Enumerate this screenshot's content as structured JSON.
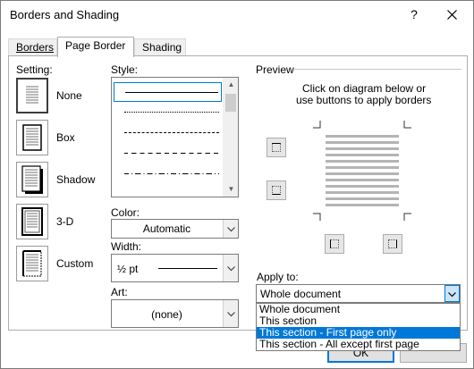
{
  "window": {
    "title": "Borders and Shading",
    "help_glyph": "?",
    "close_icon": "close-icon"
  },
  "tabs": [
    {
      "label": "Borders",
      "active": false
    },
    {
      "label": "Page Border",
      "active": true
    },
    {
      "label": "Shading",
      "active": false
    }
  ],
  "setting": {
    "heading": "Setting:",
    "items": [
      {
        "label": "None",
        "selected": false
      },
      {
        "label": "Box",
        "selected": false
      },
      {
        "label": "Shadow",
        "selected": false
      },
      {
        "label": "3-D",
        "selected": false
      },
      {
        "label": "Custom",
        "selected": false
      }
    ]
  },
  "style": {
    "heading": "Style:",
    "selected_index": 0
  },
  "color": {
    "heading": "Color:",
    "value": "Automatic"
  },
  "width": {
    "heading": "Width:",
    "value": "½ pt"
  },
  "art": {
    "heading": "Art:",
    "value": "(none)"
  },
  "preview": {
    "heading": "Preview",
    "instruction_line1": "Click on diagram below or",
    "instruction_line2": "use buttons to apply borders"
  },
  "apply_to": {
    "heading": "Apply to:",
    "value": "Whole document",
    "options": [
      "Whole document",
      "This section",
      "This section - First page only",
      "This section - All except first page"
    ],
    "highlighted_index": 2
  },
  "buttons": {
    "ok": "OK"
  },
  "colors": {
    "accent": "#0078d7",
    "highlight_text": "#ffffff"
  }
}
